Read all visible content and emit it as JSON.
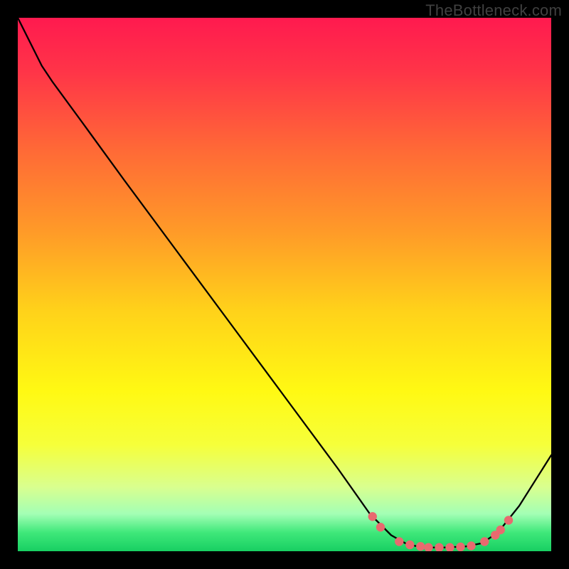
{
  "attribution": "TheBottleneck.com",
  "chart_data": {
    "type": "line",
    "title": "",
    "xlabel": "",
    "ylabel": "",
    "xlim": [
      0,
      100
    ],
    "ylim": [
      0,
      100
    ],
    "background_gradient_stops": [
      {
        "offset": 0.0,
        "color": "#ff1a4f"
      },
      {
        "offset": 0.1,
        "color": "#ff3448"
      },
      {
        "offset": 0.25,
        "color": "#ff6a36"
      },
      {
        "offset": 0.4,
        "color": "#ff9a28"
      },
      {
        "offset": 0.55,
        "color": "#ffd21a"
      },
      {
        "offset": 0.7,
        "color": "#fff913"
      },
      {
        "offset": 0.8,
        "color": "#f6ff3a"
      },
      {
        "offset": 0.88,
        "color": "#d9ff8f"
      },
      {
        "offset": 0.93,
        "color": "#a3ffb5"
      },
      {
        "offset": 0.965,
        "color": "#3fe87a"
      },
      {
        "offset": 1.0,
        "color": "#18cf62"
      }
    ],
    "curve": [
      {
        "x": 0.0,
        "y": 100.0
      },
      {
        "x": 4.5,
        "y": 91.0
      },
      {
        "x": 6.5,
        "y": 88.0
      },
      {
        "x": 12.0,
        "y": 80.5
      },
      {
        "x": 20.0,
        "y": 69.5
      },
      {
        "x": 30.0,
        "y": 56.0
      },
      {
        "x": 40.0,
        "y": 42.5
      },
      {
        "x": 50.0,
        "y": 29.0
      },
      {
        "x": 60.0,
        "y": 15.5
      },
      {
        "x": 66.0,
        "y": 7.0
      },
      {
        "x": 70.0,
        "y": 3.0
      },
      {
        "x": 73.0,
        "y": 1.3
      },
      {
        "x": 76.0,
        "y": 0.7
      },
      {
        "x": 80.0,
        "y": 0.7
      },
      {
        "x": 84.0,
        "y": 0.9
      },
      {
        "x": 87.0,
        "y": 1.5
      },
      {
        "x": 90.0,
        "y": 3.5
      },
      {
        "x": 94.0,
        "y": 8.5
      },
      {
        "x": 100.0,
        "y": 18.0
      }
    ],
    "markers": [
      {
        "x": 66.5,
        "y": 6.5
      },
      {
        "x": 68.0,
        "y": 4.5
      },
      {
        "x": 71.5,
        "y": 1.8
      },
      {
        "x": 73.5,
        "y": 1.2
      },
      {
        "x": 75.5,
        "y": 0.9
      },
      {
        "x": 77.0,
        "y": 0.7
      },
      {
        "x": 79.0,
        "y": 0.7
      },
      {
        "x": 81.0,
        "y": 0.7
      },
      {
        "x": 83.0,
        "y": 0.8
      },
      {
        "x": 85.0,
        "y": 1.0
      },
      {
        "x": 87.5,
        "y": 1.8
      },
      {
        "x": 89.5,
        "y": 3.0
      },
      {
        "x": 90.5,
        "y": 4.0
      },
      {
        "x": 92.0,
        "y": 5.8
      }
    ],
    "marker_color": "#e86a6f",
    "curve_color": "#000000",
    "curve_width": 2.3,
    "marker_radius": 6.2
  }
}
